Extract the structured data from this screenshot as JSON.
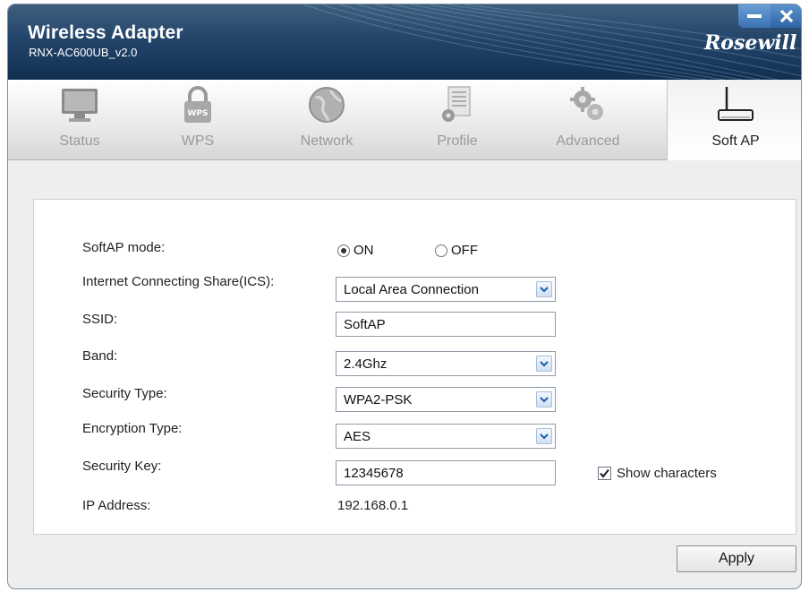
{
  "window": {
    "title": "Wireless Adapter",
    "subtitle": "RNX-AC600UB_v2.0",
    "brand": "Rosewill"
  },
  "tabs": [
    {
      "label": "Status",
      "icon": "monitor-icon",
      "active": false
    },
    {
      "label": "WPS",
      "icon": "wps-lock-icon",
      "active": false
    },
    {
      "label": "Network",
      "icon": "globe-icon",
      "active": false
    },
    {
      "label": "Profile",
      "icon": "document-gear-icon",
      "active": false
    },
    {
      "label": "Advanced",
      "icon": "gears-icon",
      "active": false
    },
    {
      "label": "Soft AP",
      "icon": "router-icon",
      "active": true
    }
  ],
  "softap": {
    "mode_label": "SoftAP mode:",
    "mode_on": "ON",
    "mode_off": "OFF",
    "mode_selected": "ON",
    "ics_label": "Internet Connecting Share(ICS):",
    "ics_value": "Local Area Connection",
    "ssid_label": "SSID:",
    "ssid_value": "SoftAP",
    "band_label": "Band:",
    "band_value": "2.4Ghz",
    "security_type_label": "Security Type:",
    "security_type_value": "WPA2-PSK",
    "encryption_label": "Encryption Type:",
    "encryption_value": "AES",
    "key_label": "Security Key:",
    "key_value": "12345678",
    "show_chars_label": "Show characters",
    "show_chars_checked": true,
    "ip_label": "IP Address:",
    "ip_value": "192.168.0.1"
  },
  "apply_label": "Apply",
  "colors": {
    "titlebar": "#24456a",
    "window_button": "#3a73b2",
    "select_arrow": "#1e5aa8"
  }
}
